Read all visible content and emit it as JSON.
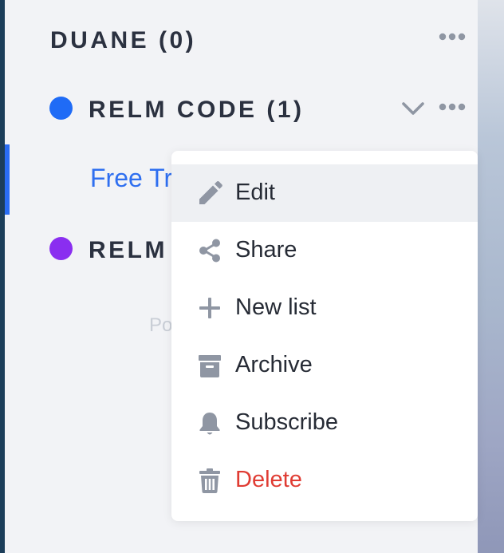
{
  "spaces": [
    {
      "name": "DUANE (0)",
      "dot_color": null
    },
    {
      "name": "RELM CODE (1)",
      "dot_color": "#1f6bf6"
    },
    {
      "name": "RELM",
      "dot_color": "#8a2ef0"
    }
  ],
  "lists": [
    {
      "label": "Free Tri"
    }
  ],
  "footer": {
    "powered_text": "Pov"
  },
  "menu": {
    "items": [
      {
        "label": "Edit",
        "icon": "pencil-icon"
      },
      {
        "label": "Share",
        "icon": "share-icon"
      },
      {
        "label": "New list",
        "icon": "plus-icon"
      },
      {
        "label": "Archive",
        "icon": "archive-icon"
      },
      {
        "label": "Subscribe",
        "icon": "bell-icon"
      },
      {
        "label": "Delete",
        "icon": "trash-icon"
      }
    ]
  },
  "colors": {
    "accent": "#2a6df4",
    "danger": "#e03c33",
    "icon_gray": "#8f96a3"
  }
}
